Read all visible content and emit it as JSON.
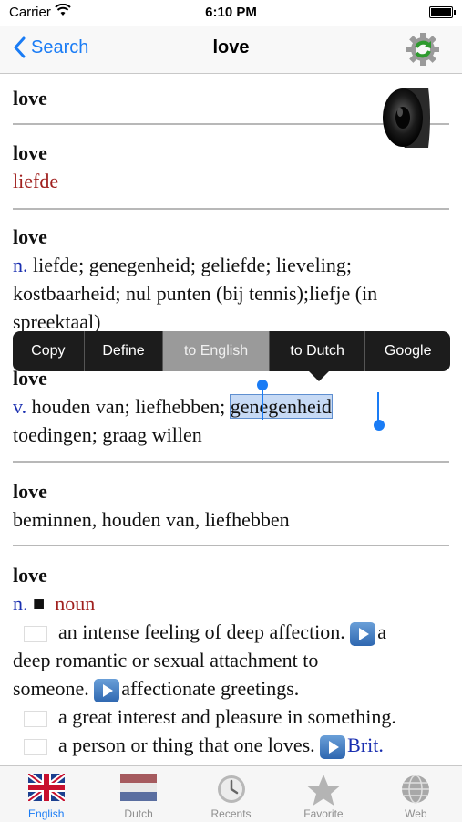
{
  "status": {
    "carrier": "Carrier",
    "time": "6:10 PM"
  },
  "nav": {
    "back": "Search",
    "title": "love"
  },
  "entries": [
    {
      "head": "love"
    },
    {
      "head": "love",
      "translation": "liefde"
    },
    {
      "head": "love",
      "pos": "n.",
      "text": "liefde; genegenheid; geliefde; lieveling; kostbaarheid; nul punten (bij tennis);liefje (in spreektaal)"
    },
    {
      "head": "love",
      "pos": "v.",
      "text_before": "houden van; liefhebben;",
      "selected": "genegenheid",
      "text_after": "toedingen; graag willen"
    },
    {
      "head": "love",
      "text": "beminnen, houden van, liefhebben"
    },
    {
      "head": "love",
      "pos": "n.",
      "square": "■",
      "word_class": "noun",
      "sense1": "an intense feeling of deep affection.",
      "sense1b_start": "a",
      "sense1b": "deep romantic or sexual attachment to",
      "sense1c": "someone.",
      "sense1d": "affectionate greetings.",
      "sense2": "a great interest and pleasure in something.",
      "sense3": "a person or thing that one loves.",
      "sense3_tail": "Brit."
    }
  ],
  "menu": [
    "Copy",
    "Define",
    "to English",
    "to Dutch",
    "Google"
  ],
  "tabs": [
    "English",
    "Dutch",
    "Recents",
    "Favorite",
    "Web"
  ]
}
